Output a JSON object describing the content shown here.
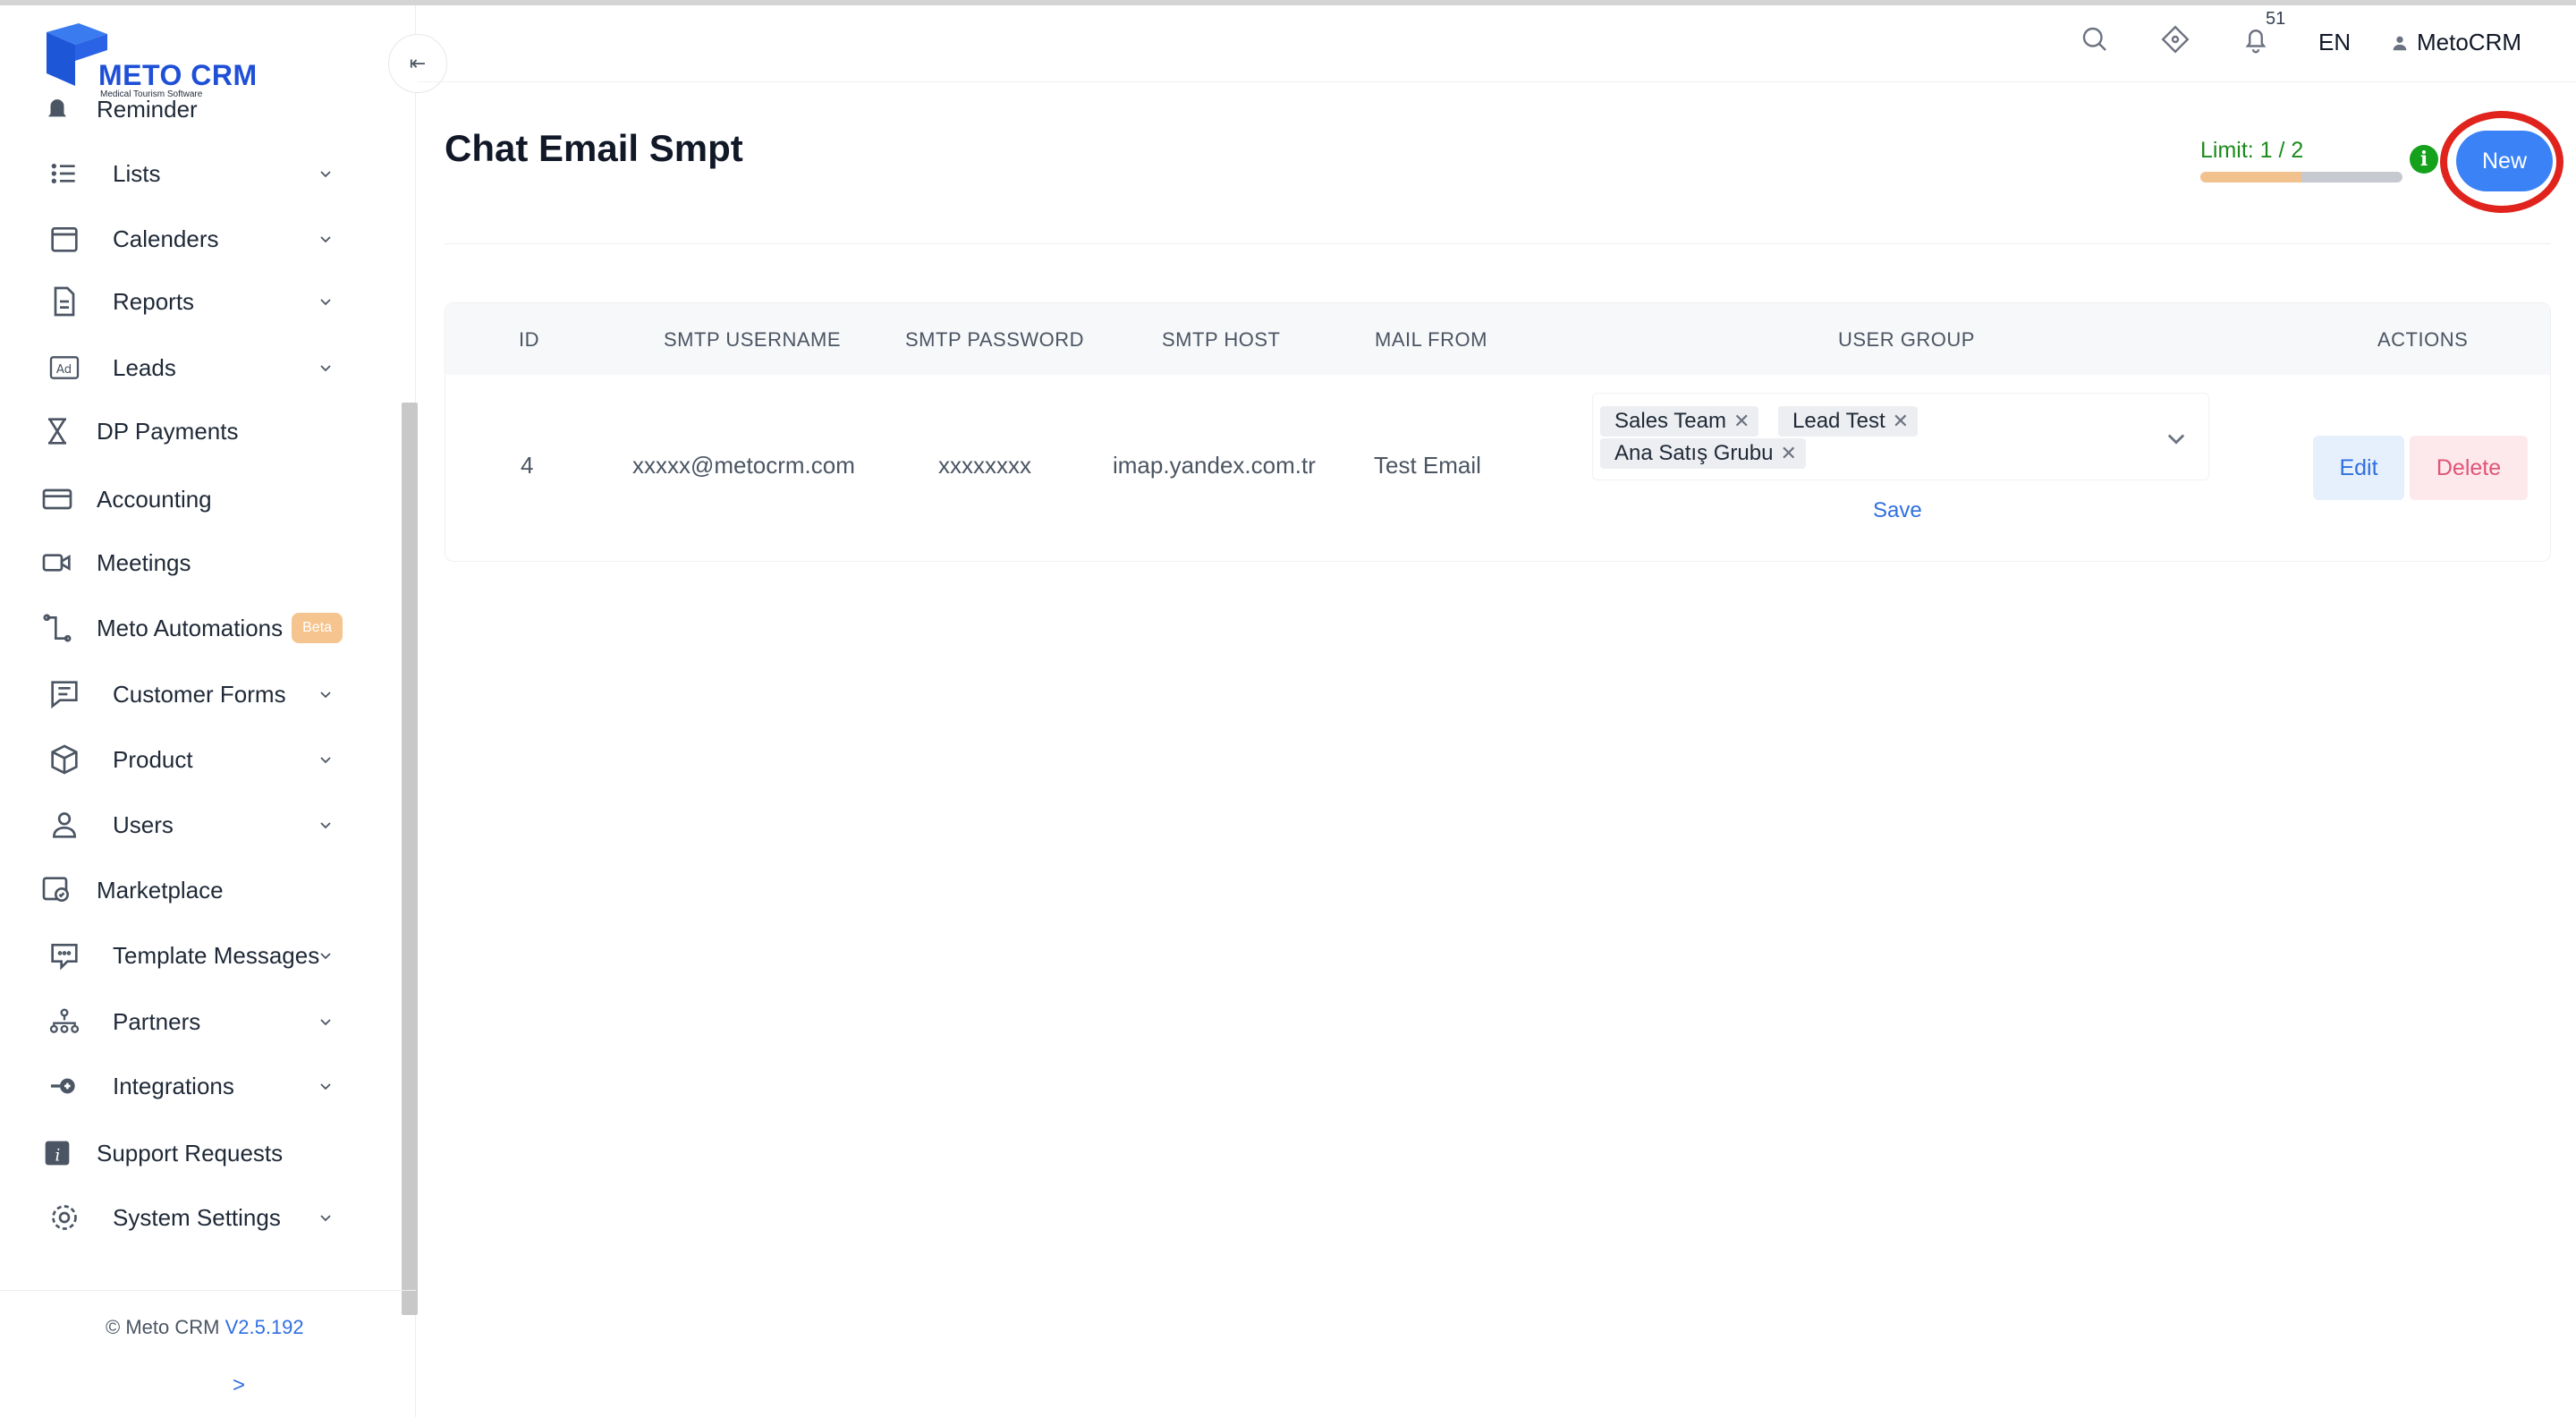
{
  "app": {
    "logo_text": "METO CRM",
    "logo_subtitle": "Medical Tourism Software",
    "brand_color": "#1e4fd6"
  },
  "header": {
    "notification_count": "51",
    "language": "EN",
    "user_name": "MetoCRM",
    "icons": [
      "search-icon",
      "diamond-icon",
      "bell-icon",
      "user-icon"
    ]
  },
  "sidebar": {
    "items": [
      {
        "label": "Reminder",
        "icon": "bell-icon",
        "has_submenu": false
      },
      {
        "label": "Lists",
        "icon": "list-icon",
        "has_submenu": true
      },
      {
        "label": "Calenders",
        "icon": "calendar-icon",
        "has_submenu": true
      },
      {
        "label": "Reports",
        "icon": "document-icon",
        "has_submenu": true
      },
      {
        "label": "Leads",
        "icon": "ad-icon",
        "has_submenu": true
      },
      {
        "label": "DP Payments",
        "icon": "hourglass-icon",
        "has_submenu": false
      },
      {
        "label": "Accounting",
        "icon": "card-icon",
        "has_submenu": false
      },
      {
        "label": "Meetings",
        "icon": "video-icon",
        "has_submenu": false
      },
      {
        "label": "Meto Automations",
        "icon": "flow-icon",
        "has_submenu": false,
        "badge": "Beta"
      },
      {
        "label": "Customer Forms",
        "icon": "form-icon",
        "has_submenu": true
      },
      {
        "label": "Product",
        "icon": "box-icon",
        "has_submenu": true
      },
      {
        "label": "Users",
        "icon": "user-icon",
        "has_submenu": true
      },
      {
        "label": "Marketplace",
        "icon": "store-icon",
        "has_submenu": false
      },
      {
        "label": "Template Messages",
        "icon": "message-icon",
        "has_submenu": true
      },
      {
        "label": "Partners",
        "icon": "partners-icon",
        "has_submenu": true
      },
      {
        "label": "Integrations",
        "icon": "plug-icon",
        "has_submenu": true
      },
      {
        "label": "Support Requests",
        "icon": "info-square-icon",
        "has_submenu": false
      },
      {
        "label": "System Settings",
        "icon": "gear-icon",
        "has_submenu": true
      }
    ],
    "footer": {
      "copyright": "© Meto CRM",
      "version": "V2.5.192",
      "expand_label": ">"
    }
  },
  "page": {
    "title": "Chat Email Smpt",
    "limit_label": "Limit: 1 / 2",
    "limit_used": 1,
    "limit_total": 2,
    "new_button": "New"
  },
  "table": {
    "columns": [
      "ID",
      "SMTP USERNAME",
      "SMTP PASSWORD",
      "SMTP HOST",
      "MAIL FROM",
      "USER GROUP",
      "ACTIONS"
    ],
    "rows": [
      {
        "id": "4",
        "smtp_username": "xxxxx@metocrm.com",
        "smtp_password": "xxxxxxxx",
        "smtp_host": "imap.yandex.com.tr",
        "mail_from": "Test Email",
        "user_groups": [
          "Sales Team",
          "Lead Test",
          "Ana Satış Grubu"
        ],
        "save_label": "Save",
        "edit_label": "Edit",
        "delete_label": "Delete"
      }
    ]
  }
}
